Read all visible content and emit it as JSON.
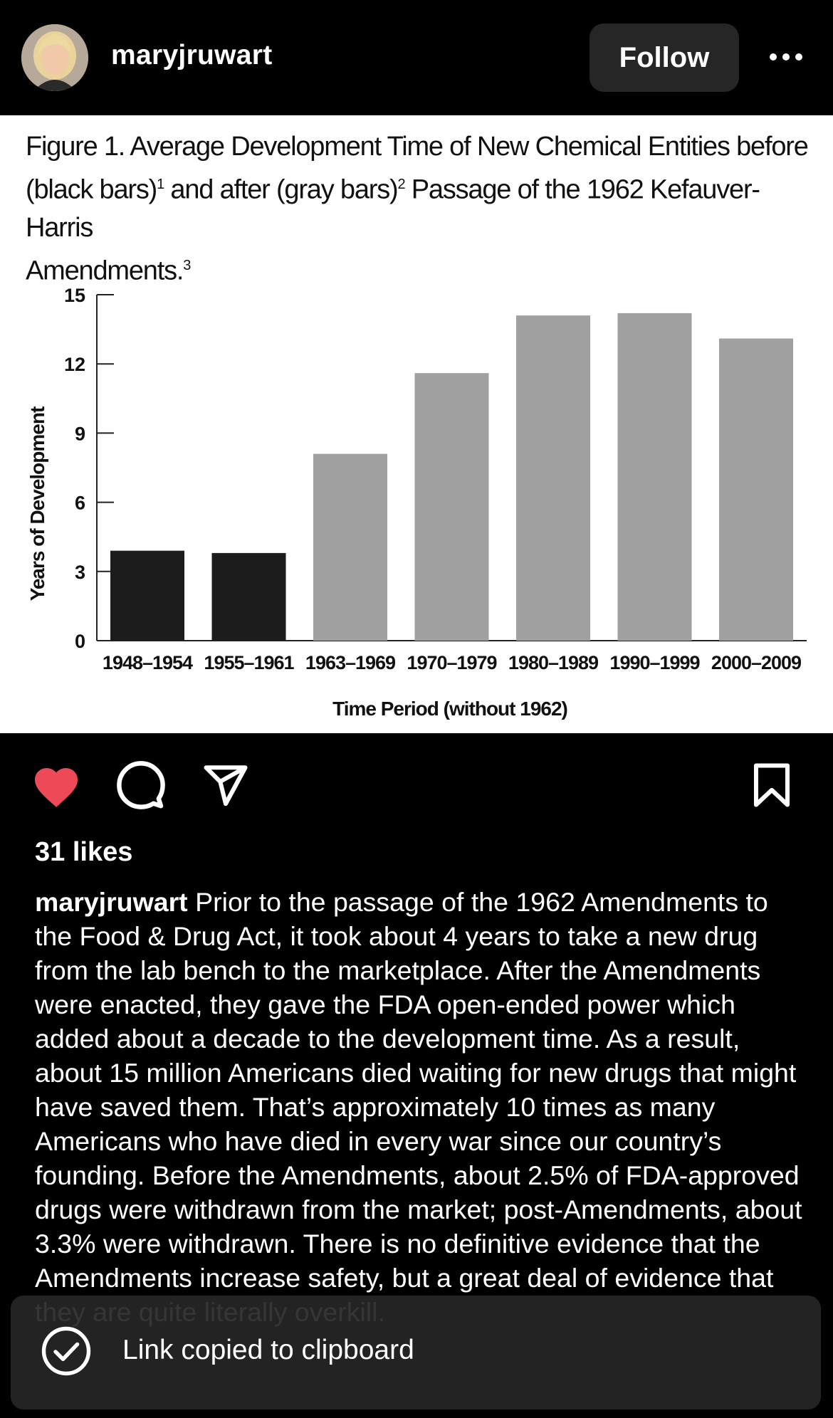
{
  "header": {
    "username": "maryjruwart",
    "follow_label": "Follow"
  },
  "figure": {
    "title_line1": "Figure 1. Average Development Time of New Chemical Entities before",
    "title_line2a": "(black bars)",
    "title_sup1": "1",
    "title_line2b": " and after (gray bars)",
    "title_sup2": "2",
    "title_line2c": " Passage of the 1962 Kefauver-Harris",
    "title_line3": "Amendments.",
    "title_sup3": "3"
  },
  "chart_data": {
    "type": "bar",
    "title": "Figure 1. Average Development Time of New Chemical Entities before (black bars) and after (gray bars) Passage of the 1962 Kefauver-Harris Amendments.",
    "xlabel": "Time Period (without 1962)",
    "ylabel": "Years of Development",
    "categories": [
      "1948–1954",
      "1955–1961",
      "1963–1969",
      "1970–1979",
      "1980–1989",
      "1990–1999",
      "2000–2009"
    ],
    "values": [
      3.9,
      3.8,
      8.1,
      11.6,
      14.1,
      14.2,
      13.1
    ],
    "bar_colors": [
      "#1c1c1c",
      "#1c1c1c",
      "#a0a0a0",
      "#a0a0a0",
      "#a0a0a0",
      "#a0a0a0",
      "#a0a0a0"
    ],
    "ylim": [
      0,
      15
    ],
    "yticks": [
      0,
      3,
      6,
      9,
      12,
      15
    ],
    "grid": false
  },
  "engagement": {
    "likes": "31 likes",
    "liked": true,
    "like_color": "#ed4956"
  },
  "caption": {
    "username": "maryjruwart",
    "text": "Prior to the passage of the 1962 Amendments to the Food & Drug Act, it took about 4 years to take a new drug from the lab bench to the marketplace. After the Amendments were enacted, they gave the FDA open-ended power which added about a decade to the development time. As a result, about 15 million Americans died waiting for new drugs that might have saved them. That’s approximately 10 times as many Americans who have died in every war since our country’s founding. Before the Amendments, about 2.5% of FDA-approved drugs were withdrawn from the market; post-Amendments, about 3.3% were withdrawn. There is no definitive evidence that the Amendments increase safety, but a great deal of evidence that they are quite literally overkill."
  },
  "toast": {
    "message": "Link copied to clipboard"
  },
  "icons": {
    "more": "more-icon",
    "like": "heart-icon",
    "comment": "comment-icon",
    "share": "send-icon",
    "save": "bookmark-icon",
    "toast": "check-circle-icon"
  }
}
